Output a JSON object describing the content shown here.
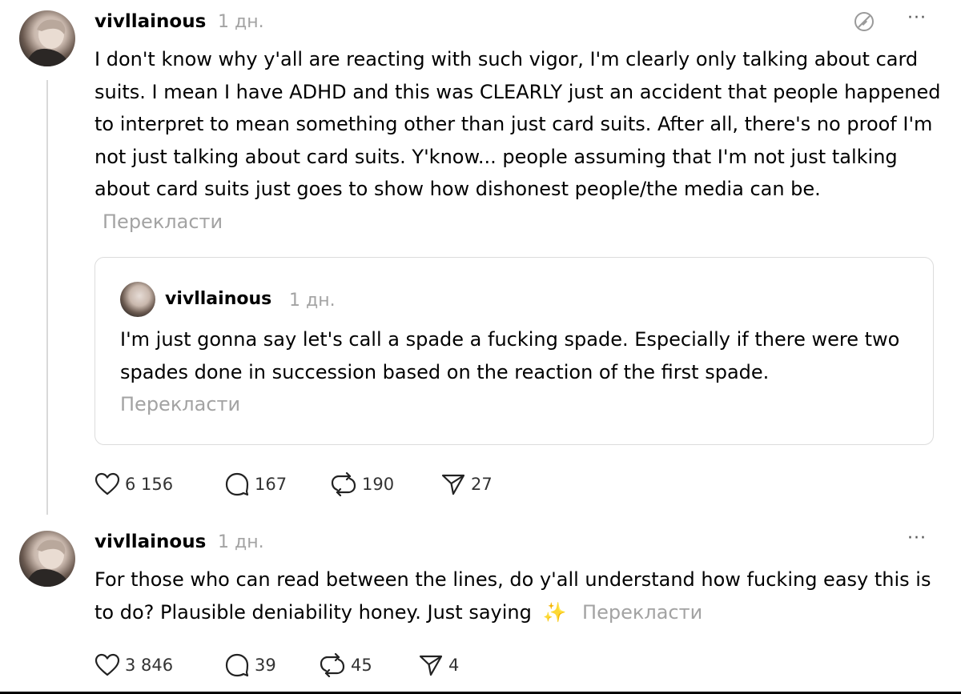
{
  "post1": {
    "username": "vivllainous",
    "time": "1 дн.",
    "body": "I don't know why y'all are reacting with such vigor, I'm clearly only talking about card suits. I mean I have ADHD and this was CLEARLY just an accident that people happened to interpret to mean something other than just card suits. After all, there's no proof I'm not just talking about card suits. Y'know... people assuming that I'm not just talking about card suits just goes to show how dishonest people/the media can be.",
    "translate": "Перекласти",
    "quote": {
      "username": "vivllainous",
      "time": "1 дн.",
      "body": "I'm just gonna say let's call a spade a fucking spade. Especially if there were two spades done in succession based on the reaction of the first spade.",
      "translate": "Перекласти"
    },
    "likes": "6 156",
    "comments": "167",
    "reposts": "190",
    "shares": "27"
  },
  "post2": {
    "username": "vivllainous",
    "time": "1 дн.",
    "body": "For those who can read between the lines, do y'all understand how fucking easy this is to do? Plausible deniability honey. Just saying",
    "emoji": "✨",
    "translate": "Перекласти",
    "likes": "3 846",
    "comments": "39",
    "reposts": "45",
    "shares": "4"
  },
  "icons": {
    "more": "more-horizontal-icon",
    "no_edit": "edit-disabled-icon",
    "like": "heart-icon",
    "comment": "comment-icon",
    "repost": "repost-icon",
    "share": "send-icon"
  },
  "colors": {
    "text": "#000000",
    "muted": "#a3a3a3",
    "border": "#dcdcdc",
    "emoji": "#f5c542"
  }
}
